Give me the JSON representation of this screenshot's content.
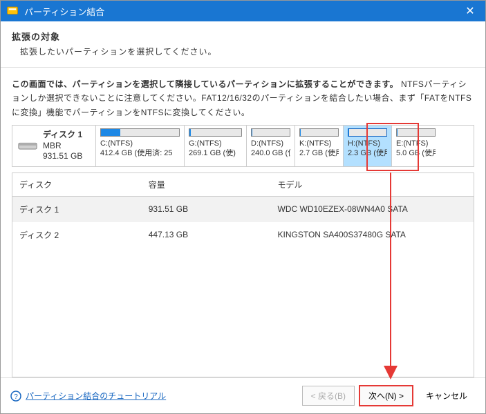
{
  "titlebar": {
    "text": "パーティション結合"
  },
  "header": {
    "title": "拡張の対象",
    "subtitle": "拡張したいパーティションを選択してください。"
  },
  "description_bold": "この画面では、パーティションを選択して隣接しているパーティションに拡張することができます。",
  "description_rest": "NTFSパーティションしか選択できないことに注意してください。FAT12/16/32のパーティションを結合したい場合、まず「FATをNTFSに変換」機能でパーティションをNTFSに変換してください。",
  "disk": {
    "name": "ディスク 1",
    "type": "MBR",
    "size": "931.51 GB"
  },
  "partitions": {
    "c": {
      "label": "C:(NTFS)",
      "size": "412.4 GB (使用済: 25",
      "fill": 25
    },
    "g": {
      "label": "G:(NTFS)",
      "size": "269.1 GB (使)",
      "fill": 2
    },
    "d": {
      "label": "D:(NTFS)",
      "size": "240.0 GB (使",
      "fill": 2
    },
    "k": {
      "label": "K:(NTFS)",
      "size": "2.7 GB (使用",
      "fill": 2
    },
    "h": {
      "label": "H:(NTFS)",
      "size": "2.3 GB (使用",
      "fill": 2
    },
    "e": {
      "label": "E:(NTFS)",
      "size": "5.0 GB (使用",
      "fill": 2
    }
  },
  "table": {
    "headers": {
      "disk": "ディスク",
      "capacity": "容量",
      "model": "モデル"
    },
    "rows": [
      {
        "disk": "ディスク 1",
        "capacity": "931.51 GB",
        "model": "WDC WD10EZEX-08WN4A0 SATA"
      },
      {
        "disk": "ディスク 2",
        "capacity": "447.13 GB",
        "model": "KINGSTON SA400S37480G SATA"
      }
    ]
  },
  "footer": {
    "help_link": "パーティション結合のチュートリアル",
    "back": "< 戻る(B)",
    "next": "次へ(N) >",
    "cancel": "キャンセル"
  }
}
